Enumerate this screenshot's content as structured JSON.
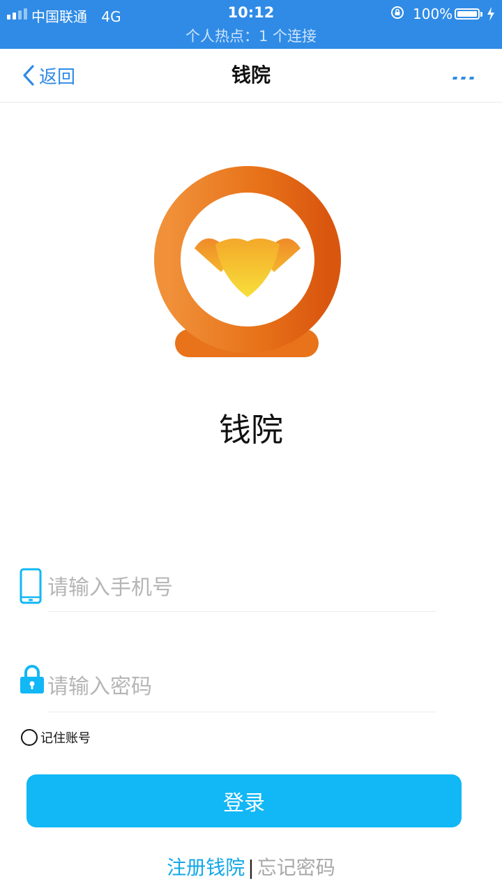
{
  "status_bar": {
    "carrier": "中国联通",
    "network": "4G",
    "time": "10:12",
    "battery": "100%",
    "hotspot": "个人热点：1 个连接"
  },
  "nav": {
    "back_label": "返回",
    "title": "钱院"
  },
  "app": {
    "name": "钱院"
  },
  "form": {
    "phone_placeholder": "请输入手机号",
    "password_placeholder": "请输入密码",
    "remember_label": "记住账号",
    "login_label": "登录"
  },
  "links": {
    "register": "注册钱院",
    "separator": "|",
    "forgot": "忘记密码"
  },
  "colors": {
    "status_bar_bg": "#2f8be6",
    "accent": "#12b7f5",
    "logo_orange": "#e8731a",
    "logo_gold": "#f5c22c"
  },
  "icons": [
    "signal-icon",
    "rotation-lock-icon",
    "battery-icon",
    "charging-bolt-icon",
    "back-chevron-icon",
    "more-icon",
    "phone-icon",
    "lock-icon"
  ]
}
